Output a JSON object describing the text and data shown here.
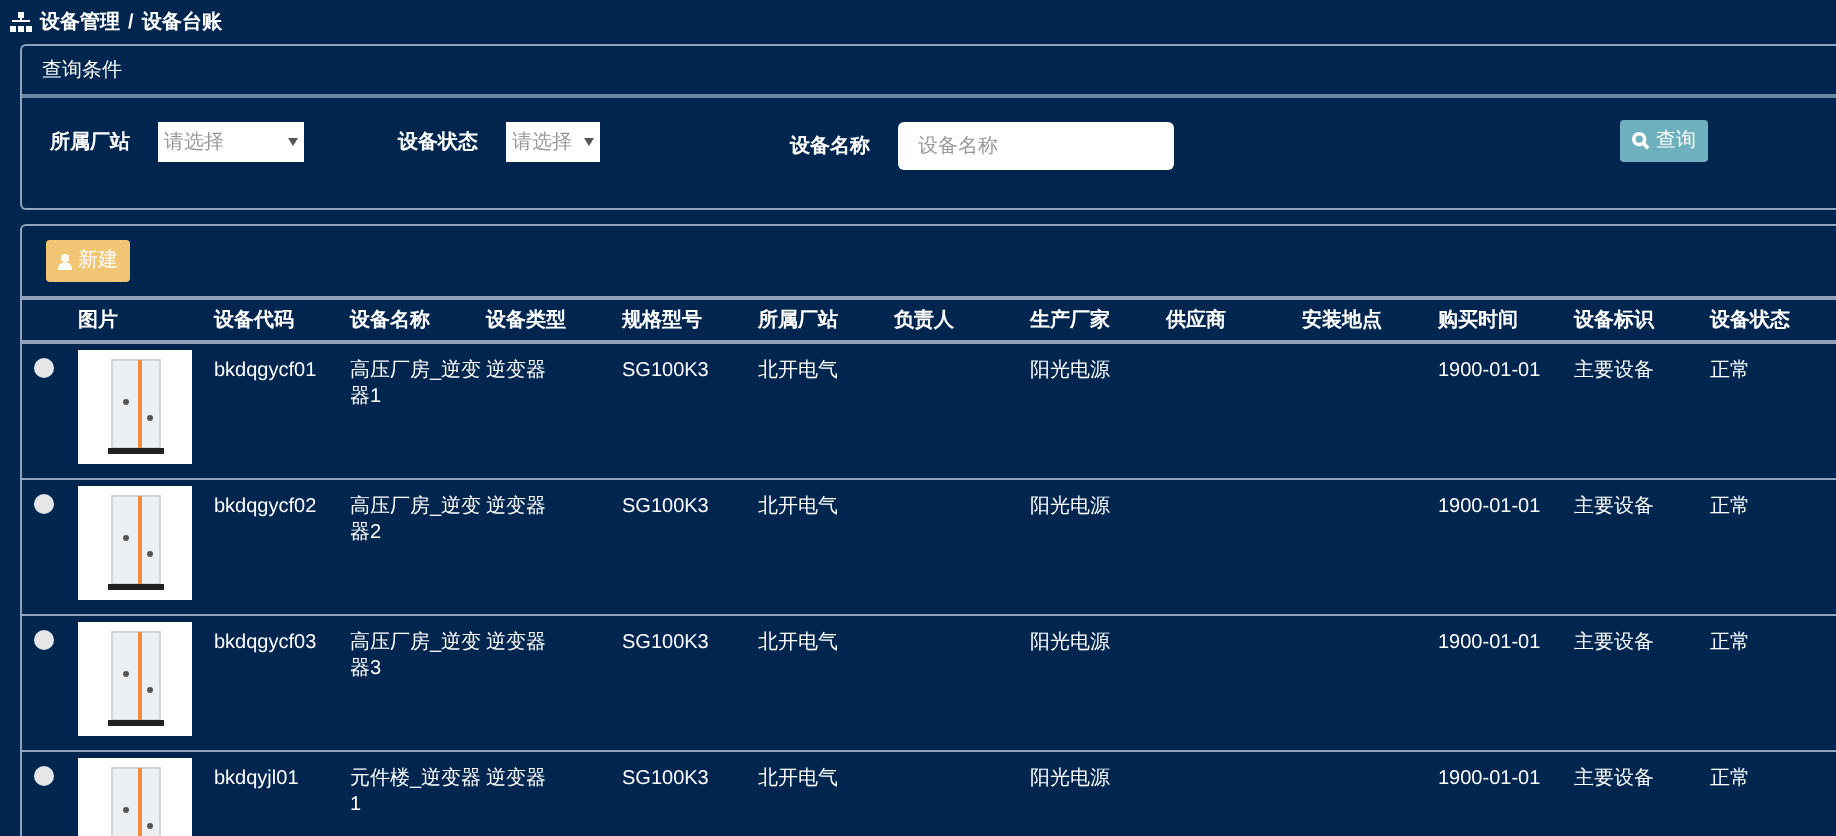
{
  "breadcrumb": [
    "设备管理",
    "/",
    "设备台账"
  ],
  "query_panel": {
    "title": "查询条件",
    "fields": [
      {
        "kind": "select",
        "label": "所属厂站",
        "placeholder": "请选择"
      },
      {
        "kind": "select",
        "label": "设备状态",
        "placeholder": "请选择"
      },
      {
        "kind": "text",
        "label": "设备名称",
        "placeholder": "设备名称"
      }
    ],
    "search_button": "查询"
  },
  "new_button": "新建",
  "table": {
    "columns": [
      "图片",
      "设备代码",
      "设备名称",
      "设备类型",
      "规格型号",
      "所属厂站",
      "负责人",
      "生产厂家",
      "供应商",
      "安装地点",
      "购买时间",
      "设备标识",
      "设备状态"
    ],
    "rows": [
      {
        "selected": false,
        "code": "bkdqgycf01",
        "name": "高压厂房_逆变器1",
        "type": "逆变器",
        "model": "SG100K3",
        "station": "北开电气",
        "owner": "",
        "maker": "阳光电源",
        "supplier": "",
        "location": "",
        "purchased": "1900-01-01",
        "tag": "主要设备",
        "status": "正常"
      },
      {
        "selected": false,
        "code": "bkdqgycf02",
        "name": "高压厂房_逆变器2",
        "type": "逆变器",
        "model": "SG100K3",
        "station": "北开电气",
        "owner": "",
        "maker": "阳光电源",
        "supplier": "",
        "location": "",
        "purchased": "1900-01-01",
        "tag": "主要设备",
        "status": "正常"
      },
      {
        "selected": false,
        "code": "bkdqgycf03",
        "name": "高压厂房_逆变器3",
        "type": "逆变器",
        "model": "SG100K3",
        "station": "北开电气",
        "owner": "",
        "maker": "阳光电源",
        "supplier": "",
        "location": "",
        "purchased": "1900-01-01",
        "tag": "主要设备",
        "status": "正常"
      },
      {
        "selected": false,
        "code": "bkdqyjl01",
        "name": "元件楼_逆变器1",
        "type": "逆变器",
        "model": "SG100K3",
        "station": "北开电气",
        "owner": "",
        "maker": "阳光电源",
        "supplier": "",
        "location": "",
        "purchased": "1900-01-01",
        "tag": "主要设备",
        "status": "正常"
      }
    ]
  }
}
